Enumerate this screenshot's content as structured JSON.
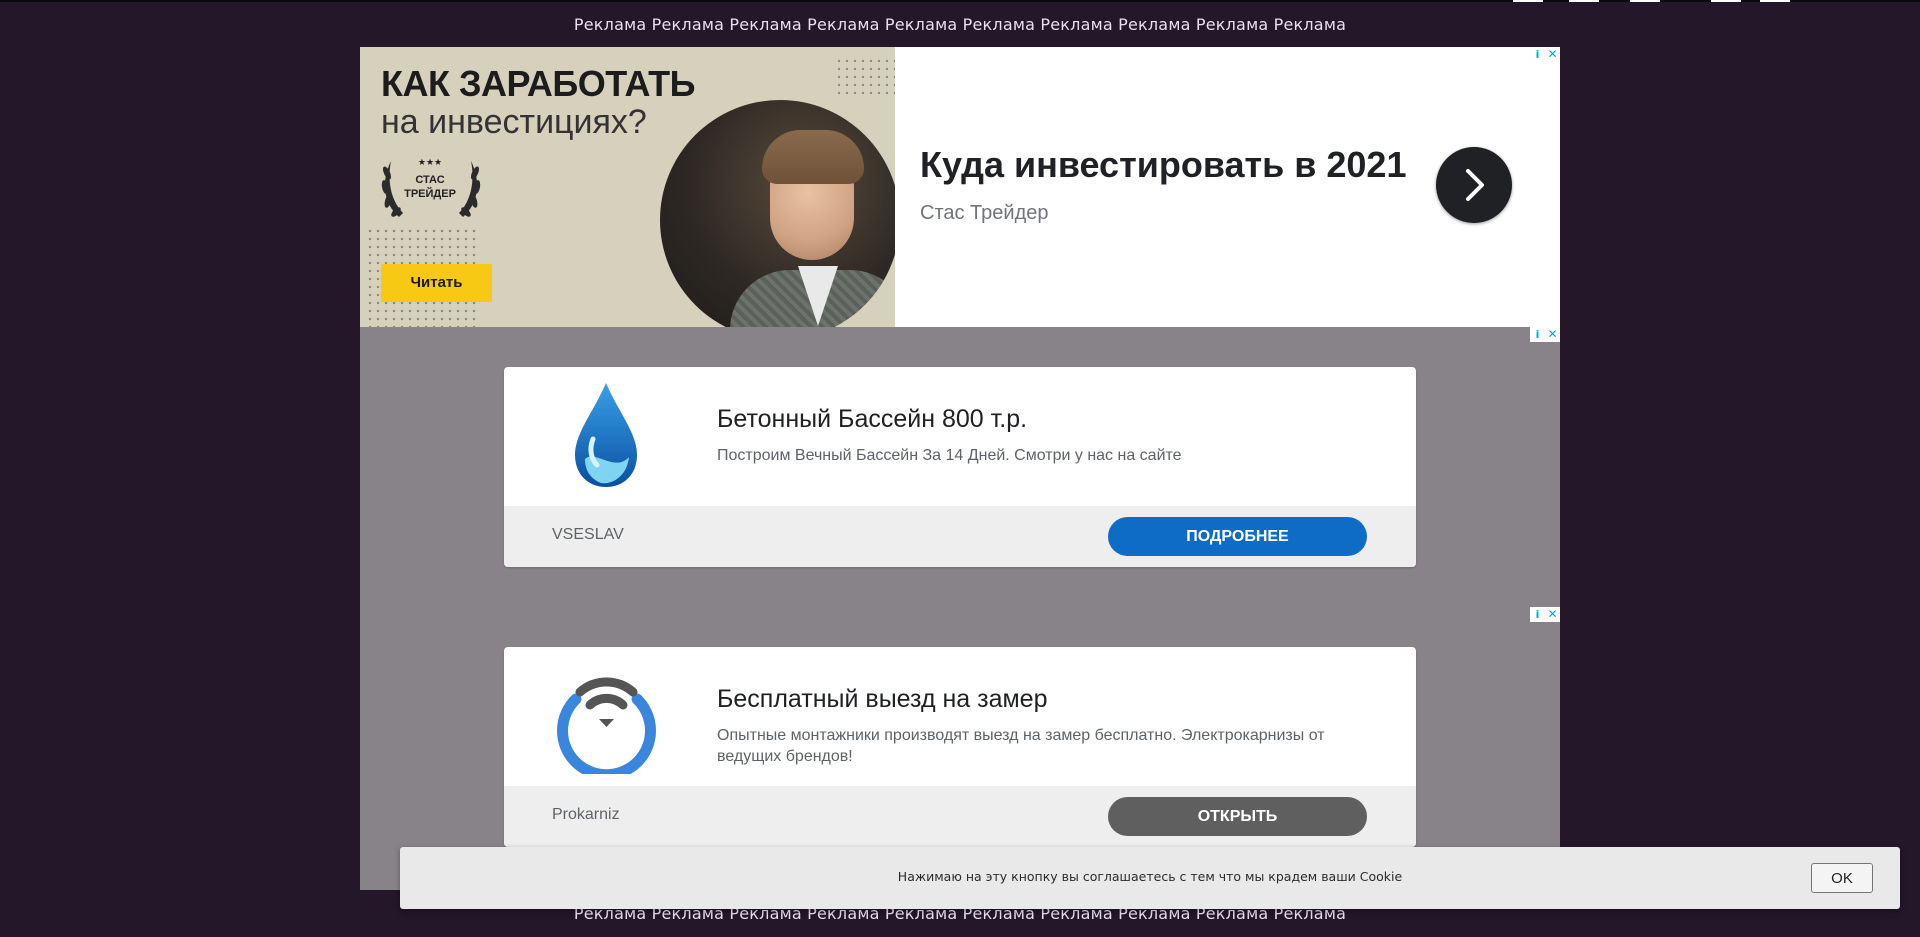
{
  "reklama_top": "Реклама Реклама Реклама Реклама Реклама Реклама Реклама Реклама Реклама Реклама",
  "reklama_bottom": "Реклама Реклама Реклама Реклама Реклама Реклама Реклама Реклама Реклама Реклама",
  "banner": {
    "title": "КАК ЗАРАБОТАТЬ",
    "subtitle": "на инвестициях?",
    "laurel_stars": "★★★",
    "laurel_line1": "СТАС",
    "laurel_line2": "ТРЕЙДЕР",
    "read_label": "Читать",
    "headline": "Куда инвестировать в 2021",
    "advertiser": "Стас Трейдер"
  },
  "ad_choices": {
    "info": "i",
    "close": "✕"
  },
  "cards": [
    {
      "title": "Бетонный Бассейн 800 т.р.",
      "description": "Построим Вечный Бассейн За 14 Дней. Смотри у нас на сайте",
      "advertiser": "VSESLAV",
      "button": "ПОДРОБНЕЕ",
      "button_color": "#0f6cc6",
      "logo_icon": "water-drop-icon"
    },
    {
      "title": "Бесплатный выезд на замер",
      "description": "Опытные монтажники производят выезд на замер бесплатно. Электрокарнизы от ведущих брендов!",
      "advertiser": "Prokarniz",
      "button": "ОТКРЫТЬ",
      "button_color": "#5f5f5f",
      "logo_icon": "wifi-circle-icon"
    }
  ],
  "cookie": {
    "text": "Нажимаю на эту кнопку вы соглашаетесь с тем что мы крадем ваши Cookie",
    "ok_label": "OK"
  },
  "colors": {
    "page_background": "#231729",
    "ad_background": "#878389",
    "banner_accent": "#f8c914"
  }
}
